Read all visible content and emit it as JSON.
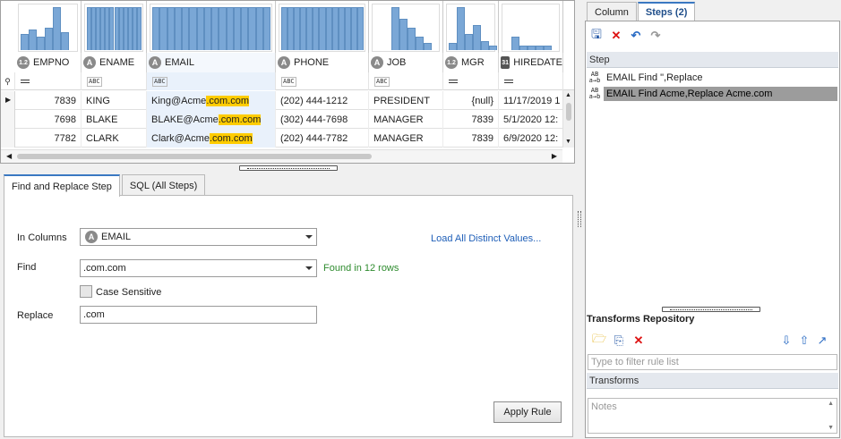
{
  "grid": {
    "columns": [
      {
        "name": "EMPNO",
        "type_badge": "1.2",
        "hist": [
          0.35,
          0.45,
          0.3,
          0.5,
          0.95,
          0.4
        ]
      },
      {
        "name": "ENAME",
        "type_badge": "A",
        "hist": [
          0.95,
          0.95,
          0.95,
          0.95,
          0.95,
          0.95,
          0.95,
          0.95,
          0.95,
          0.95,
          0.95,
          0.95
        ]
      },
      {
        "name": "EMAIL",
        "type_badge": "A",
        "hist": [
          0.95,
          0.95,
          0.95,
          0.95,
          0.95,
          0.95,
          0.95,
          0.95,
          0.95,
          0.95,
          0.95,
          0.95,
          0.95,
          0.95,
          0.95,
          0.95
        ]
      },
      {
        "name": "PHONE",
        "type_badge": "A",
        "hist": [
          0.95,
          0.95,
          0.95,
          0.95,
          0.95,
          0.95,
          0.95,
          0.95,
          0.95,
          0.95,
          0.95,
          0.95,
          0.95
        ]
      },
      {
        "name": "JOB",
        "type_badge": "A",
        "hist": [
          0.95,
          0.7,
          0.5,
          0.3,
          0.15
        ]
      },
      {
        "name": "MGR",
        "type_badge": "1.2",
        "hist": [
          0.15,
          0.95,
          0.35,
          0.55,
          0.2,
          0.1
        ]
      },
      {
        "name": "HIREDATE",
        "type_badge": "31",
        "hist": [
          0.3,
          0.1,
          0.1,
          0.1,
          0.1
        ]
      }
    ],
    "rows": [
      {
        "empno": "7839",
        "ename": "KING",
        "email_pre": "King@Acme",
        "email_hl": ".com.com",
        "phone": "(202) 444-1212",
        "job": "PRESIDENT",
        "mgr": "{null}",
        "hiredate": "11/17/2019 1"
      },
      {
        "empno": "7698",
        "ename": "BLAKE",
        "email_pre": "BLAKE@Acme",
        "email_hl": ".com.com",
        "phone": "(302) 444-7698",
        "job": "MANAGER",
        "mgr": "7839",
        "hiredate": "5/1/2020 12:"
      },
      {
        "empno": "7782",
        "ename": "CLARK",
        "email_pre": "Clark@Acme",
        "email_hl": ".com.com",
        "phone": "(202) 444-7782",
        "job": "MANAGER",
        "mgr": "7839",
        "hiredate": "6/9/2020 12:"
      }
    ],
    "filter_abc": "ABC"
  },
  "bottom_tabs": [
    {
      "label": "Find and Replace Step",
      "active": true
    },
    {
      "label": "SQL (All Steps)",
      "active": false
    }
  ],
  "form": {
    "in_columns_label": "In Columns",
    "in_columns_badge": "A",
    "in_columns_value": "EMAIL",
    "load_distinct": "Load All Distinct Values...",
    "find_label": "Find",
    "find_value": ".com.com",
    "found_text": "Found in 12 rows",
    "case_sensitive_label": "Case Sensitive",
    "replace_label": "Replace",
    "replace_value": ".com",
    "apply_label": "Apply Rule"
  },
  "right_tabs": [
    {
      "label": "Column",
      "active": false
    },
    {
      "label": "Steps (2)",
      "active": true
    }
  ],
  "steps": {
    "header": "Step",
    "items": [
      {
        "text": "EMAIL Find \",Replace",
        "selected": false
      },
      {
        "text": "EMAIL Find Acme,Replace Acme.com",
        "selected": true
      }
    ]
  },
  "repository": {
    "title": "Transforms Repository",
    "filter_placeholder": "Type to filter rule list",
    "transforms_header": "Transforms",
    "notes_placeholder": "Notes"
  },
  "colors": {
    "accent": "#3a78c2",
    "highlight": "#ffcc00",
    "bar": "#7aa7d6",
    "found": "#2e8b2e"
  }
}
